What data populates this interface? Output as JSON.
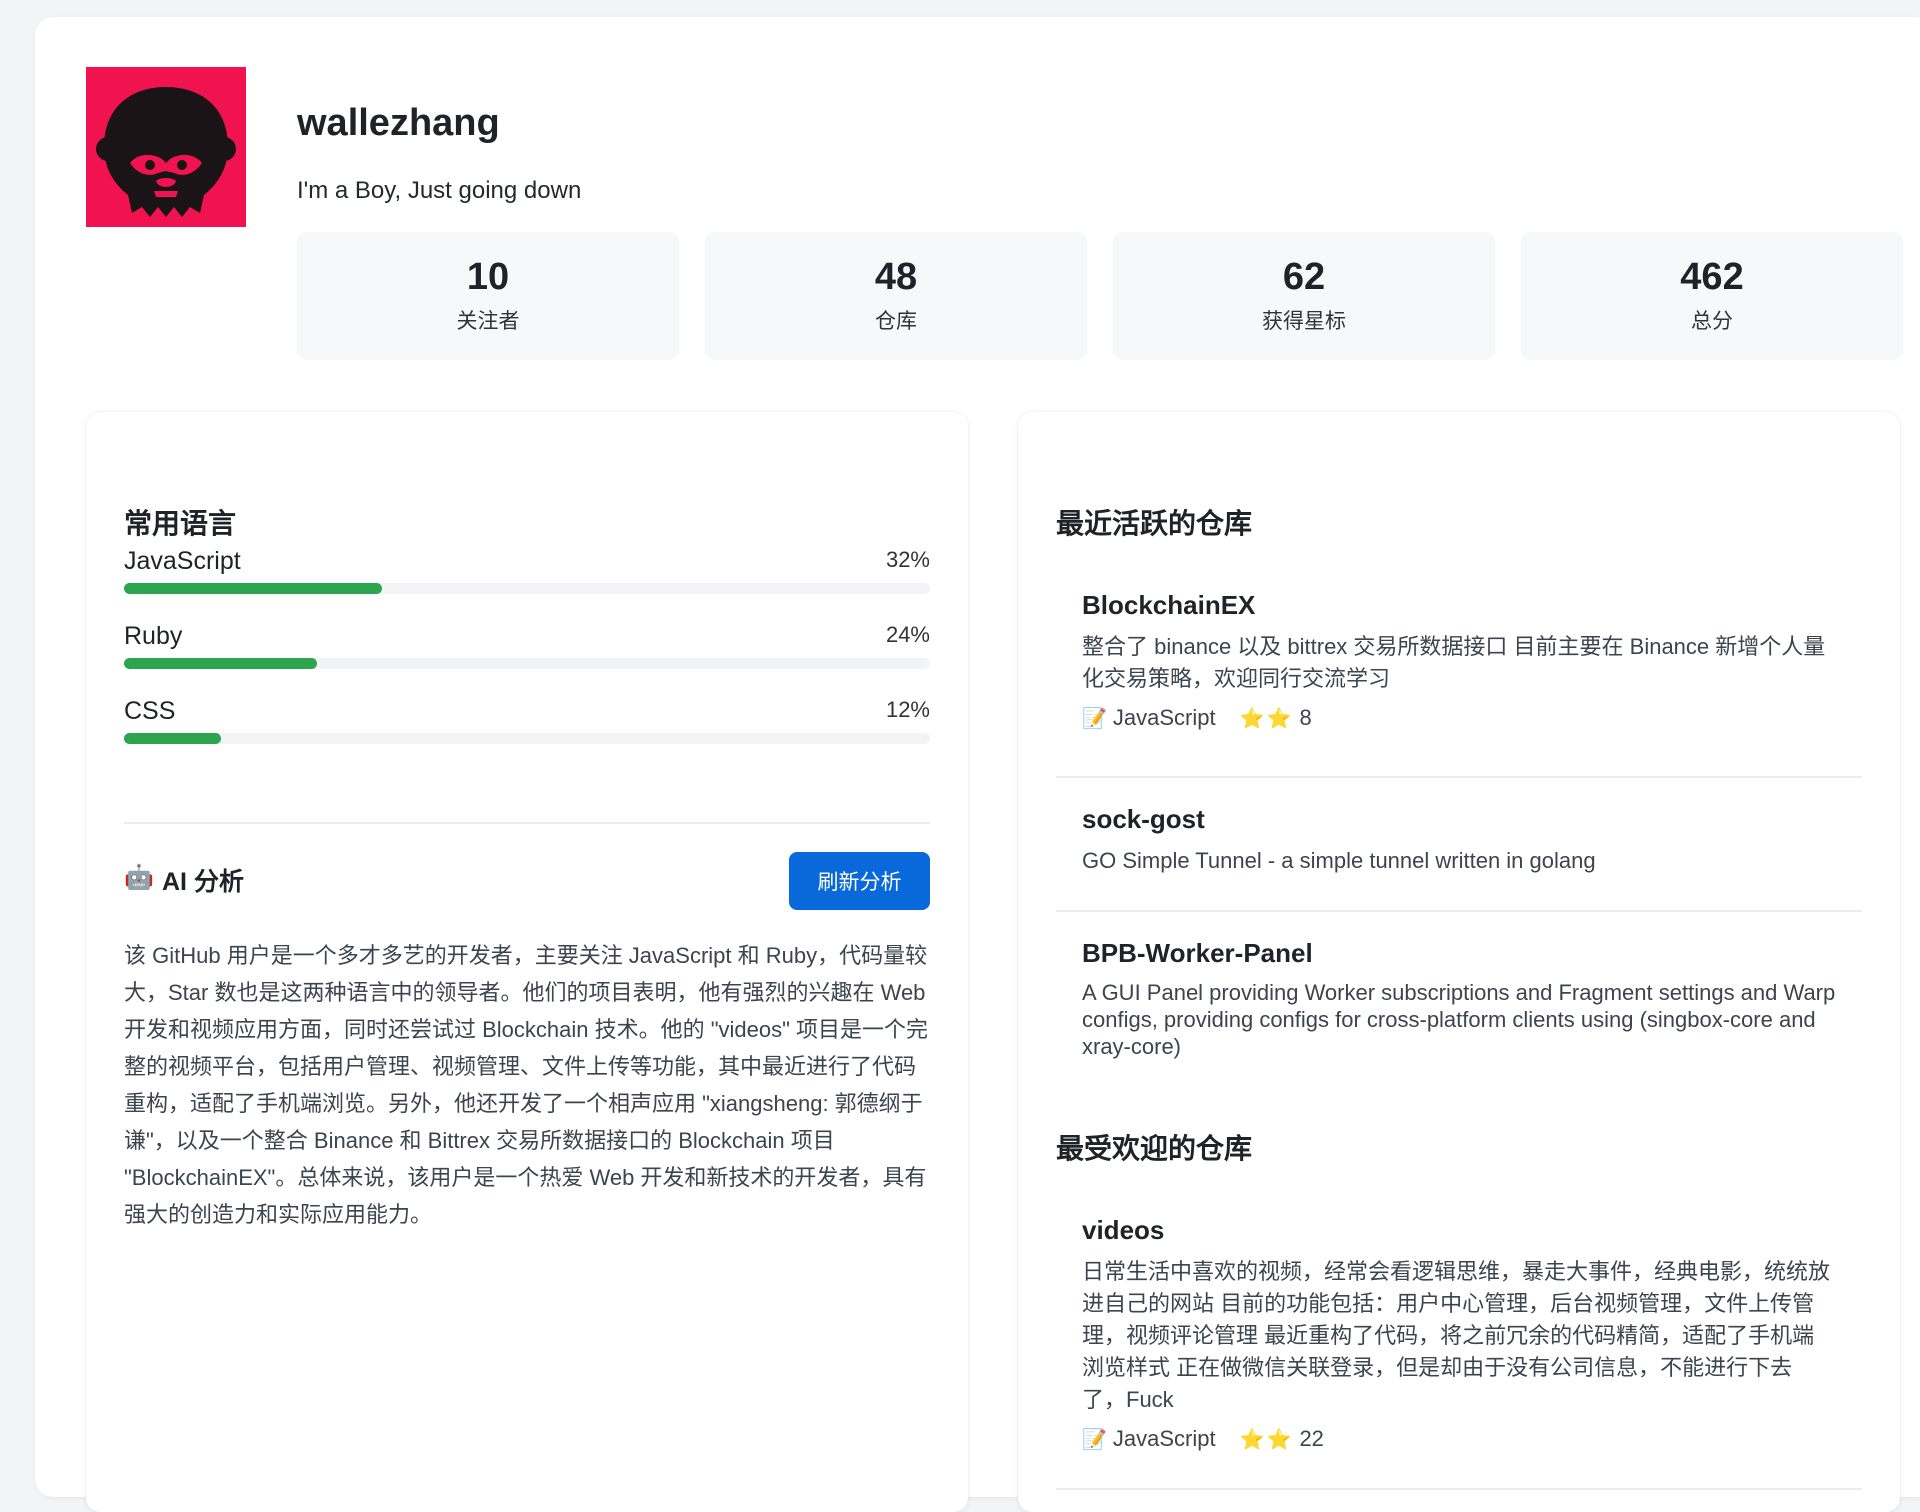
{
  "profile": {
    "username": "wallezhang",
    "bio": "I'm a Boy, Just going down"
  },
  "stats": [
    {
      "value": "10",
      "label": "关注者"
    },
    {
      "value": "48",
      "label": "仓库"
    },
    {
      "value": "62",
      "label": "获得星标"
    },
    {
      "value": "462",
      "label": "总分"
    }
  ],
  "languages": {
    "title": "常用语言",
    "items": [
      {
        "name": "JavaScript",
        "percent": "32%",
        "fraction": 0.32
      },
      {
        "name": "Ruby",
        "percent": "24%",
        "fraction": 0.24
      },
      {
        "name": "CSS",
        "percent": "12%",
        "fraction": 0.12
      }
    ]
  },
  "ai": {
    "icon": "🤖",
    "title": "AI 分析",
    "refresh_label": "刷新分析",
    "text": "该 GitHub 用户是一个多才多艺的开发者，主要关注 JavaScript 和 Ruby，代码量较大，Star 数也是这两种语言中的领导者。他们的项目表明，他有强烈的兴趣在 Web 开发和视频应用方面，同时还尝试过 Blockchain 技术。他的 \"videos\" 项目是一个完整的视频平台，包括用户管理、视频管理、文件上传等功能，其中最近进行了代码重构，适配了手机端浏览。另外，他还开发了一个相声应用 \"xiangsheng: 郭德纲于谦\"，以及一个整合 Binance 和 Bittrex 交易所数据接口的 Blockchain 项目 \"BlockchainEX\"。总体来说，该用户是一个热爱 Web 开发和新技术的开发者，具有强大的创造力和实际应用能力。"
  },
  "recent": {
    "title": "最近活跃的仓库",
    "repos": [
      {
        "name": "BlockchainEX",
        "description": "整合了 binance 以及 bittrex 交易所数据接口 目前主要在 Binance 新增个人量化交易策略，欢迎同行交流学习",
        "language_icon": "📝",
        "language": "JavaScript",
        "star_icon": "⭐⭐",
        "stars": "8"
      },
      {
        "name": "sock-gost",
        "description": "GO Simple Tunnel - a simple tunnel written in golang"
      },
      {
        "name": "BPB-Worker-Panel",
        "description": "A GUI Panel providing Worker subscriptions and Fragment settings and Warp configs, providing configs for cross-platform clients using (singbox-core and xray-core)"
      }
    ]
  },
  "popular": {
    "title": "最受欢迎的仓库",
    "repos": [
      {
        "name": "videos",
        "description": "日常生活中喜欢的视频，经常会看逻辑思维，暴走大事件，经典电影，统统放进自己的网站 目前的功能包括：用户中心管理，后台视频管理，文件上传管理，视频评论管理 最近重构了代码，将之前冗余的代码精简，适配了手机端浏览样式 正在做微信关联登录，但是却由于没有公司信息，不能进行下去了，Fuck",
        "language_icon": "📝",
        "language": "JavaScript",
        "star_icon": "⭐⭐",
        "stars": "22"
      }
    ]
  }
}
